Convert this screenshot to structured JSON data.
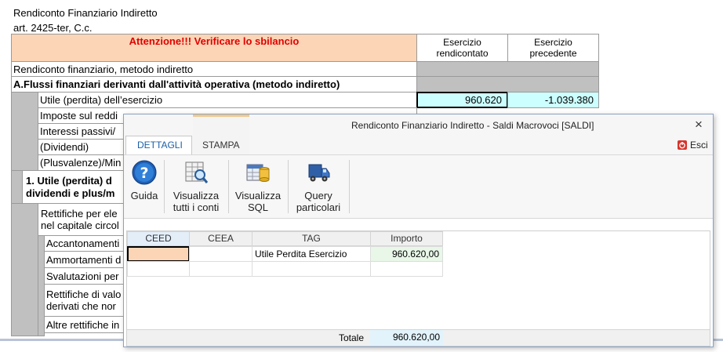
{
  "sheet": {
    "title": "Rendiconto Finanziario Indiretto",
    "subtitle": "art. 2425-ter, C.c.",
    "warning": "Attenzione!!! Verificare lo sbilancio",
    "col_current": "Esercizio rendicontato",
    "col_previous": "Esercizio precedente",
    "section_label": "Rendiconto finanziario, metodo indiretto",
    "section_a": "A.Flussi finanziari derivanti dall'attività operativa (metodo indiretto)",
    "rows": [
      {
        "label": "Utile (perdita) dell’esercizio",
        "current": "960.620",
        "previous": "-1.039.380"
      },
      {
        "label": "Imposte sul reddi"
      },
      {
        "label": "Interessi passivi/"
      },
      {
        "label": "(Dividendi)"
      },
      {
        "label": "(Plusvalenze)/Min"
      }
    ],
    "sub_section_1_line1": "1. Utile (perdita) d",
    "sub_section_1_line2": "dividendi e plus/m",
    "rettifiche_line1": "Rettifiche per ele",
    "rettifiche_line2": "nel capitale circol",
    "rows2": [
      {
        "label": "Accantonamenti"
      },
      {
        "label": "Ammortamenti d"
      },
      {
        "label": "Svalutazioni per"
      }
    ],
    "rettifiche_valore_line1": "Rettifiche di valo",
    "rettifiche_valore_line2": "derivati che nor",
    "altre_rettifiche": "Altre rettifiche in"
  },
  "dialog": {
    "title": "Rendiconto Finanziario Indiretto - Saldi Macrovoci [SALDI]",
    "close_label": "×",
    "tabs": [
      "DETTAGLI",
      "STAMPA"
    ],
    "exit_label": "Esci",
    "buttons": [
      {
        "label_1": "Guida",
        "label_2": "",
        "icon": "help-icon"
      },
      {
        "label_1": "Visualizza",
        "label_2": "tutti i conti",
        "icon": "view-all-accounts-icon"
      },
      {
        "label_1": "Visualizza",
        "label_2": "SQL",
        "icon": "view-sql-icon"
      },
      {
        "label_1": "Query",
        "label_2": "particolari",
        "icon": "query-truck-icon"
      }
    ],
    "grid": {
      "columns": [
        "CEED",
        "CEEA",
        "TAG",
        "Importo"
      ],
      "rows": [
        {
          "ceed": "",
          "ceea": "",
          "tag": "Utile Perdita Esercizio",
          "importo": "960.620,00"
        },
        {
          "ceed": "",
          "ceea": "",
          "tag": "",
          "importo": ""
        }
      ],
      "total_label": "Totale",
      "total_value": "960.620,00"
    }
  },
  "colors": {
    "warning_bg": "#fbd5b5",
    "warning_text": "#e00000",
    "grey_cell": "#c0c0c0",
    "cyan_cell": "#ccffff",
    "green_cell": "#e8f7e8",
    "tab_accent": "#f0c88a",
    "tab_active_text": "#1a5fa8"
  }
}
